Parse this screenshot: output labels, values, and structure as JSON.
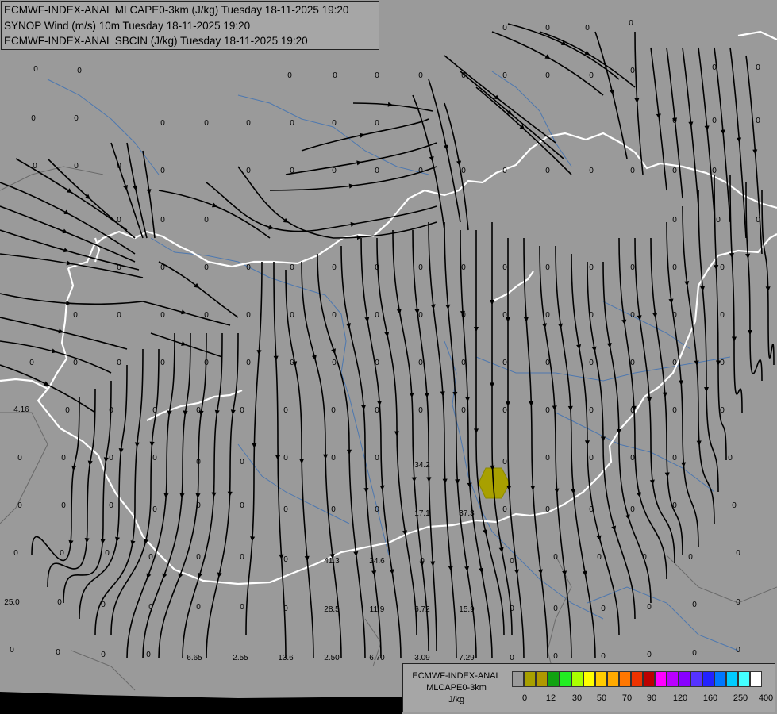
{
  "titles": {
    "line1": "ECMWF-INDEX-ANAL MLCAPE0-3km (J/kg) Tuesday 18-11-2025 19:20",
    "line2": "SYNOP Wind (m/s) 10m Tuesday 18-11-2025 19:20",
    "line3": "ECMWF-INDEX-ANAL SBCIN (J/kg) Tuesday 18-11-2025 19:20"
  },
  "legend": {
    "title": "ECMWF-INDEX-ANAL",
    "subtitle": "MLCAPE0-3km",
    "unit": "J/kg",
    "colors": [
      "#9a9a9a",
      "#a8a000",
      "#b09800",
      "#11a311",
      "#22ee22",
      "#aaff00",
      "#ffff00",
      "#ffcc00",
      "#ffaa00",
      "#ff7700",
      "#ee3300",
      "#bb0000",
      "#ff00ff",
      "#bb00ff",
      "#8800ff",
      "#5533ff",
      "#2222ff",
      "#0077ff",
      "#00ccff",
      "#44ffff",
      "#ffffff"
    ],
    "tick_labels": [
      "0",
      "12",
      "30",
      "50",
      "70",
      "90",
      "120",
      "160",
      "250",
      "400"
    ]
  },
  "map": {
    "cape_color": "#a8a000",
    "field_labels": [
      "0",
      "0",
      "0",
      "0",
      "0",
      "0",
      "0",
      "0",
      "0",
      "0",
      "0",
      "0",
      "0",
      "0",
      "0",
      "0",
      "0",
      "0",
      "0",
      "0",
      "4.16",
      "25.0",
      "0",
      "0",
      "0",
      "0",
      "0",
      "6.65",
      "2.55",
      "13.6",
      "2.50",
      "6.70",
      "3.09",
      "7.29",
      "0",
      "34.2",
      "37.3",
      "17.1",
      "24.6",
      "41.3",
      "28.5",
      "11.9",
      "6.72",
      "15.9"
    ]
  }
}
